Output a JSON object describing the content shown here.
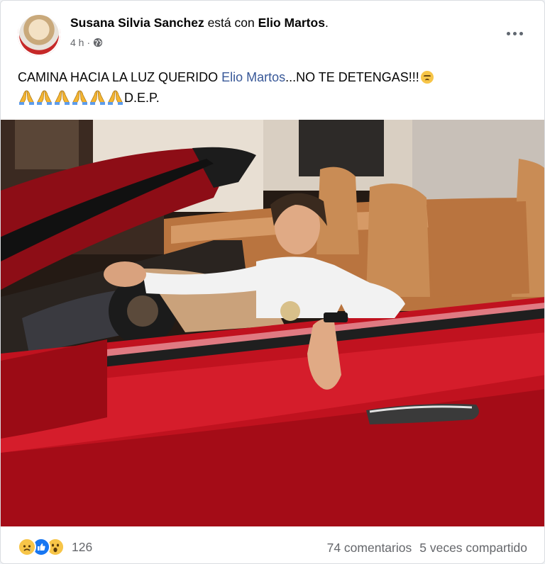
{
  "post": {
    "author": "Susana Silvia Sanchez",
    "with_word": "está con",
    "tagged": "Elio Martos",
    "tagged_suffix": ".",
    "time": "4 h",
    "text_part1": "CAMINA HACIA LA LUZ QUERIDO ",
    "mention": "Elio Martos",
    "text_part2": "...NO TE DETENGAS!!!",
    "text_line2": "D.E.P.",
    "pray_emoji_count": 6
  },
  "footer": {
    "reaction_icons": [
      "sad-reaction-icon",
      "like-reaction-icon",
      "wow-reaction-icon"
    ],
    "reactions_count": "126",
    "comments": "74 comentarios",
    "shares": "5 veces compartido"
  },
  "colors": {
    "link": "#385898",
    "meta_text": "#65676b",
    "like_blue": "#1877f2",
    "car_red": "#c0121f",
    "leather_tan": "#c98c55"
  }
}
